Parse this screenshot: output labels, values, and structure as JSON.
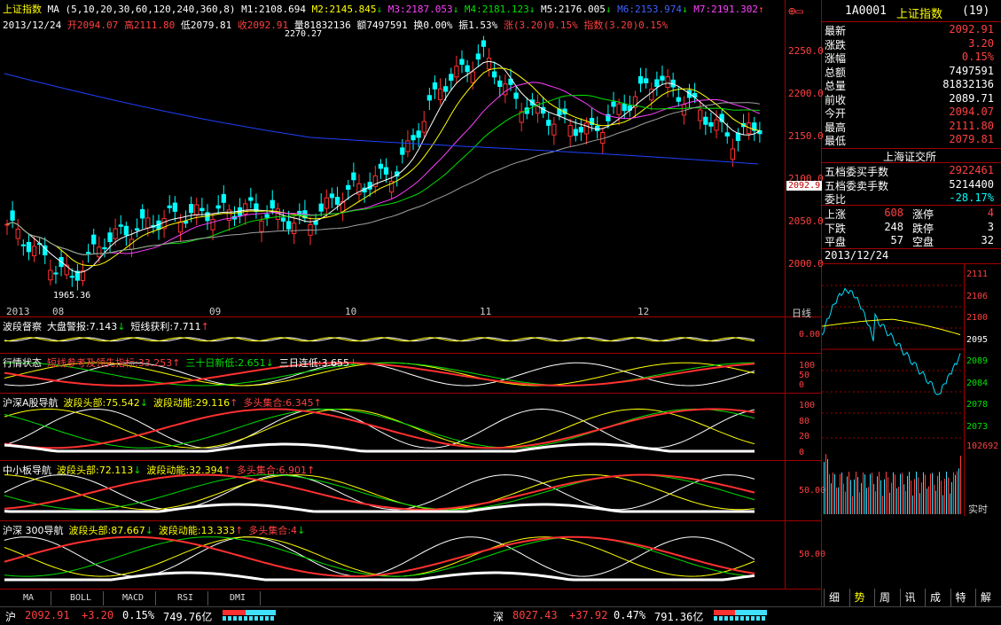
{
  "header": {
    "index_name": "上证指数",
    "ma_params": "MA (5,10,20,30,60,120,240,360,8)",
    "m1": "M1:2108.694",
    "m2": "M2:2145.845",
    "m3": "M3:2187.053",
    "m4": "M4:2181.123",
    "m5": "M5:2176.005",
    "m6": "M6:2153.974",
    "m7": "M7:2191.302",
    "date": "2013/12/24",
    "open": "开2094.07",
    "high": "高2111.80",
    "low": "低2079.81",
    "close": "收2092.91",
    "volume": "量81832136",
    "amount": "额7497591",
    "turnover": "换0.00%",
    "amplitude": "振1.53%",
    "change": "涨(3.20)0.15%",
    "index_change": "指数(3.20)0.15%"
  },
  "main_chart": {
    "price_ticks": [
      "2250.0",
      "2200.0",
      "2150.0",
      "2100.0",
      "2050.0",
      "2000.0"
    ],
    "current_price_tag": "2092.9",
    "high_annotation": "2270.27",
    "low_annotation": "1965.36",
    "x_labels": [
      "2013",
      "08",
      "09",
      "10",
      "11",
      "12"
    ],
    "period_label": "日线"
  },
  "panels": [
    {
      "name": "panel-wave-watch",
      "title": "波段督察",
      "items": [
        {
          "text": "大盘警报:7.143",
          "arrow": "↓",
          "color": "#ffffff"
        },
        {
          "text": "短线获利:7.711",
          "arrow": "↑",
          "color": "#ffffff"
        }
      ],
      "ticks": [
        "0.00"
      ]
    },
    {
      "name": "panel-market-state",
      "title": "行情状态",
      "items": [
        {
          "text": "短线参考及领先指标:33.253",
          "arrow": "↑",
          "color": "#ff4040"
        },
        {
          "text": "三十日新低:2.651",
          "arrow": "↓",
          "color": "#00e000"
        },
        {
          "text": "三日连低:3.655",
          "arrow": "↓",
          "color": "#ffffff"
        }
      ],
      "ticks": [
        "100",
        "50",
        "0"
      ]
    },
    {
      "name": "panel-sh-sz-a",
      "title": "沪深A股导航",
      "items": [
        {
          "text": "波段头部:75.542",
          "arrow": "↓",
          "color": "#ffff00"
        },
        {
          "text": "波段动能:29.116",
          "arrow": "↑",
          "color": "#ffff00"
        },
        {
          "text": "多头集合:6.345",
          "arrow": "↑",
          "color": "#ff4040"
        }
      ],
      "ticks": [
        "100",
        "80",
        "20",
        "0"
      ]
    },
    {
      "name": "panel-sme",
      "title": "中小板导航",
      "items": [
        {
          "text": "波段头部:72.113",
          "arrow": "↓",
          "color": "#ffff00"
        },
        {
          "text": "波段动能:32.394",
          "arrow": "↑",
          "color": "#ffff00"
        },
        {
          "text": "多头集合:6.901",
          "arrow": "↑",
          "color": "#ff4040"
        }
      ],
      "ticks": [
        "50.00"
      ]
    },
    {
      "name": "panel-hs300",
      "title": "沪深 300导航",
      "items": [
        {
          "text": "波段头部:87.667",
          "arrow": "↓",
          "color": "#ffff00"
        },
        {
          "text": "波段动能:13.333",
          "arrow": "↑",
          "color": "#ffff00"
        },
        {
          "text": "多头集合:4",
          "arrow": "↓",
          "color": "#ff4040"
        }
      ],
      "ticks": [
        "50.00"
      ]
    }
  ],
  "bottom_tabs": [
    "MA",
    "BOLL",
    "MACD",
    "RSI",
    "DMI"
  ],
  "right_panel": {
    "code": "1A0001",
    "name": "上证指数",
    "suffix": "(19)",
    "quotes": [
      {
        "label": "最新",
        "value": "2092.91",
        "color": "#ff4040"
      },
      {
        "label": "涨跌",
        "value": "3.20",
        "color": "#ff4040"
      },
      {
        "label": "涨幅",
        "value": "0.15%",
        "color": "#ff4040"
      },
      {
        "label": "总额",
        "value": "7497591",
        "color": "#ffffff"
      },
      {
        "label": "总量",
        "value": "81832136",
        "color": "#ffffff"
      },
      {
        "label": "前收",
        "value": "2089.71",
        "color": "#ffffff"
      },
      {
        "label": "今开",
        "value": "2094.07",
        "color": "#ff4040"
      },
      {
        "label": "最高",
        "value": "2111.80",
        "color": "#ff4040"
      },
      {
        "label": "最低",
        "value": "2079.81",
        "color": "#ff4040"
      }
    ],
    "exchange": "上海证交所",
    "order_rows": [
      {
        "label": "五档委买手数",
        "value": "2922461",
        "color": "#ff4040"
      },
      {
        "label": "五档委卖手数",
        "value": "5214400",
        "color": "#ffffff"
      },
      {
        "label": "委比",
        "value": "-28.17%",
        "color": "#00ffff"
      }
    ],
    "breadth": [
      {
        "l1": "上涨",
        "v1": "608",
        "c1": "#ff4040",
        "l2": "涨停",
        "v2": "4",
        "c2": "#ff4040"
      },
      {
        "l1": "下跌",
        "v1": "248",
        "c1": "#ffffff",
        "l2": "跌停",
        "v2": "3",
        "c2": "#ffffff"
      },
      {
        "l1": "平盘",
        "v1": "57",
        "c1": "#ffffff",
        "l2": "空盘",
        "v2": "32",
        "c2": "#ffffff"
      }
    ],
    "mini_date": "2013/12/24",
    "mini_ticks": [
      "2111",
      "2106",
      "2100",
      "2095",
      "2089",
      "2084",
      "2078",
      "2073"
    ],
    "vol_tick": "102692",
    "realtime_label": "实时",
    "tabs": [
      "细",
      "势",
      "周",
      "讯",
      "成",
      "特",
      "解"
    ]
  },
  "status": {
    "sh_label": "沪",
    "sh_price": "2092.91",
    "sh_change": "+3.20",
    "sh_pct": "0.15%",
    "sh_amount": "749.76亿",
    "sz_label": "深",
    "sz_price": "8027.43",
    "sz_change": "+37.92",
    "sz_pct": "0.47%",
    "sz_amount": "791.36亿"
  },
  "colors": {
    "up": "#ff4040",
    "down": "#00ffff",
    "grid": "#a00000",
    "ma5": "#ffffff",
    "ma10": "#ffff00",
    "ma20": "#ff40ff",
    "ma30": "#00e000",
    "ma60": "#808080",
    "ma120": "#2040ff"
  }
}
